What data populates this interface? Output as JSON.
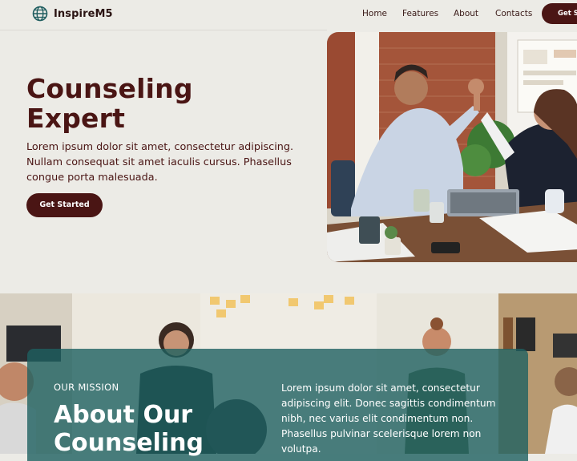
{
  "brand": {
    "name": "InspireM5",
    "logo_icon": "globe-icon"
  },
  "nav": {
    "links": [
      "Home",
      "Features",
      "About",
      "Contacts"
    ],
    "cta": "Get Started"
  },
  "hero": {
    "title_line1": "Counseling",
    "title_line2": "Expert",
    "text": "Lorem ipsum dolor sit amet, consectetur adipiscing. Nullam consequat sit amet iaculis cursus. Phasellus congue porta malesuada.",
    "button": "Get Started"
  },
  "mission": {
    "eyebrow": "OUR MISSION",
    "title": "About Our Counseling",
    "text": "Lorem ipsum dolor sit amet, consectetur adipiscing elit. Donec sagittis condimentum nibh, nec varius elit condimentum non. Phasellus pulvinar scelerisque lorem non volutpa."
  },
  "colors": {
    "background": "#ecebe6",
    "primary": "#4a1514",
    "teal_panel": "#1e6060",
    "button_text": "#ffffff"
  }
}
